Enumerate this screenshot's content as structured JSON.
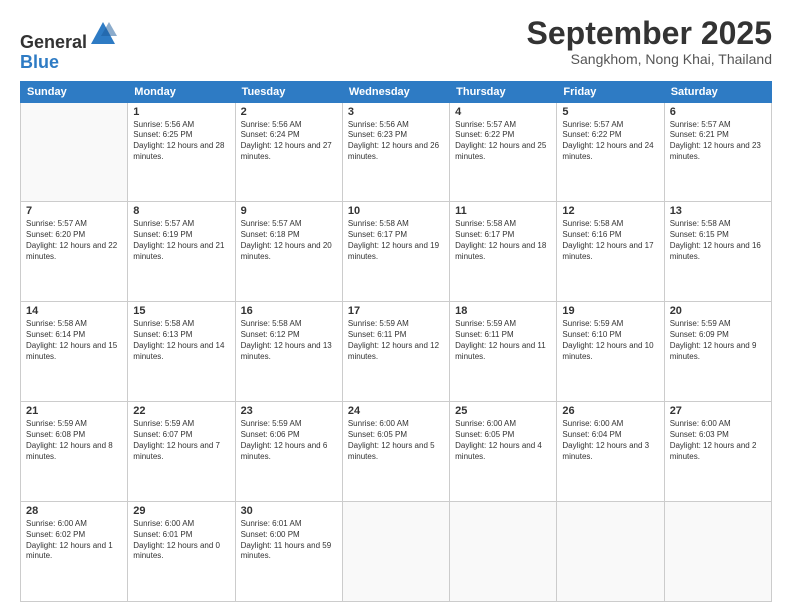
{
  "header": {
    "logo_line1": "General",
    "logo_line2": "Blue",
    "month_title": "September 2025",
    "location": "Sangkhom, Nong Khai, Thailand"
  },
  "days_of_week": [
    "Sunday",
    "Monday",
    "Tuesday",
    "Wednesday",
    "Thursday",
    "Friday",
    "Saturday"
  ],
  "weeks": [
    [
      {
        "day": "",
        "empty": true
      },
      {
        "day": "1",
        "sunrise": "5:56 AM",
        "sunset": "6:25 PM",
        "daylight": "12 hours and 28 minutes."
      },
      {
        "day": "2",
        "sunrise": "5:56 AM",
        "sunset": "6:24 PM",
        "daylight": "12 hours and 27 minutes."
      },
      {
        "day": "3",
        "sunrise": "5:56 AM",
        "sunset": "6:23 PM",
        "daylight": "12 hours and 26 minutes."
      },
      {
        "day": "4",
        "sunrise": "5:57 AM",
        "sunset": "6:22 PM",
        "daylight": "12 hours and 25 minutes."
      },
      {
        "day": "5",
        "sunrise": "5:57 AM",
        "sunset": "6:22 PM",
        "daylight": "12 hours and 24 minutes."
      },
      {
        "day": "6",
        "sunrise": "5:57 AM",
        "sunset": "6:21 PM",
        "daylight": "12 hours and 23 minutes."
      }
    ],
    [
      {
        "day": "7",
        "sunrise": "5:57 AM",
        "sunset": "6:20 PM",
        "daylight": "12 hours and 22 minutes."
      },
      {
        "day": "8",
        "sunrise": "5:57 AM",
        "sunset": "6:19 PM",
        "daylight": "12 hours and 21 minutes."
      },
      {
        "day": "9",
        "sunrise": "5:57 AM",
        "sunset": "6:18 PM",
        "daylight": "12 hours and 20 minutes."
      },
      {
        "day": "10",
        "sunrise": "5:58 AM",
        "sunset": "6:17 PM",
        "daylight": "12 hours and 19 minutes."
      },
      {
        "day": "11",
        "sunrise": "5:58 AM",
        "sunset": "6:17 PM",
        "daylight": "12 hours and 18 minutes."
      },
      {
        "day": "12",
        "sunrise": "5:58 AM",
        "sunset": "6:16 PM",
        "daylight": "12 hours and 17 minutes."
      },
      {
        "day": "13",
        "sunrise": "5:58 AM",
        "sunset": "6:15 PM",
        "daylight": "12 hours and 16 minutes."
      }
    ],
    [
      {
        "day": "14",
        "sunrise": "5:58 AM",
        "sunset": "6:14 PM",
        "daylight": "12 hours and 15 minutes."
      },
      {
        "day": "15",
        "sunrise": "5:58 AM",
        "sunset": "6:13 PM",
        "daylight": "12 hours and 14 minutes."
      },
      {
        "day": "16",
        "sunrise": "5:58 AM",
        "sunset": "6:12 PM",
        "daylight": "12 hours and 13 minutes."
      },
      {
        "day": "17",
        "sunrise": "5:59 AM",
        "sunset": "6:11 PM",
        "daylight": "12 hours and 12 minutes."
      },
      {
        "day": "18",
        "sunrise": "5:59 AM",
        "sunset": "6:11 PM",
        "daylight": "12 hours and 11 minutes."
      },
      {
        "day": "19",
        "sunrise": "5:59 AM",
        "sunset": "6:10 PM",
        "daylight": "12 hours and 10 minutes."
      },
      {
        "day": "20",
        "sunrise": "5:59 AM",
        "sunset": "6:09 PM",
        "daylight": "12 hours and 9 minutes."
      }
    ],
    [
      {
        "day": "21",
        "sunrise": "5:59 AM",
        "sunset": "6:08 PM",
        "daylight": "12 hours and 8 minutes."
      },
      {
        "day": "22",
        "sunrise": "5:59 AM",
        "sunset": "6:07 PM",
        "daylight": "12 hours and 7 minutes."
      },
      {
        "day": "23",
        "sunrise": "5:59 AM",
        "sunset": "6:06 PM",
        "daylight": "12 hours and 6 minutes."
      },
      {
        "day": "24",
        "sunrise": "6:00 AM",
        "sunset": "6:05 PM",
        "daylight": "12 hours and 5 minutes."
      },
      {
        "day": "25",
        "sunrise": "6:00 AM",
        "sunset": "6:05 PM",
        "daylight": "12 hours and 4 minutes."
      },
      {
        "day": "26",
        "sunrise": "6:00 AM",
        "sunset": "6:04 PM",
        "daylight": "12 hours and 3 minutes."
      },
      {
        "day": "27",
        "sunrise": "6:00 AM",
        "sunset": "6:03 PM",
        "daylight": "12 hours and 2 minutes."
      }
    ],
    [
      {
        "day": "28",
        "sunrise": "6:00 AM",
        "sunset": "6:02 PM",
        "daylight": "12 hours and 1 minute."
      },
      {
        "day": "29",
        "sunrise": "6:00 AM",
        "sunset": "6:01 PM",
        "daylight": "12 hours and 0 minutes."
      },
      {
        "day": "30",
        "sunrise": "6:01 AM",
        "sunset": "6:00 PM",
        "daylight": "11 hours and 59 minutes."
      },
      {
        "day": "",
        "empty": true
      },
      {
        "day": "",
        "empty": true
      },
      {
        "day": "",
        "empty": true
      },
      {
        "day": "",
        "empty": true
      }
    ]
  ],
  "labels": {
    "sunrise_prefix": "Sunrise: ",
    "sunset_prefix": "Sunset: ",
    "daylight_prefix": "Daylight: "
  }
}
